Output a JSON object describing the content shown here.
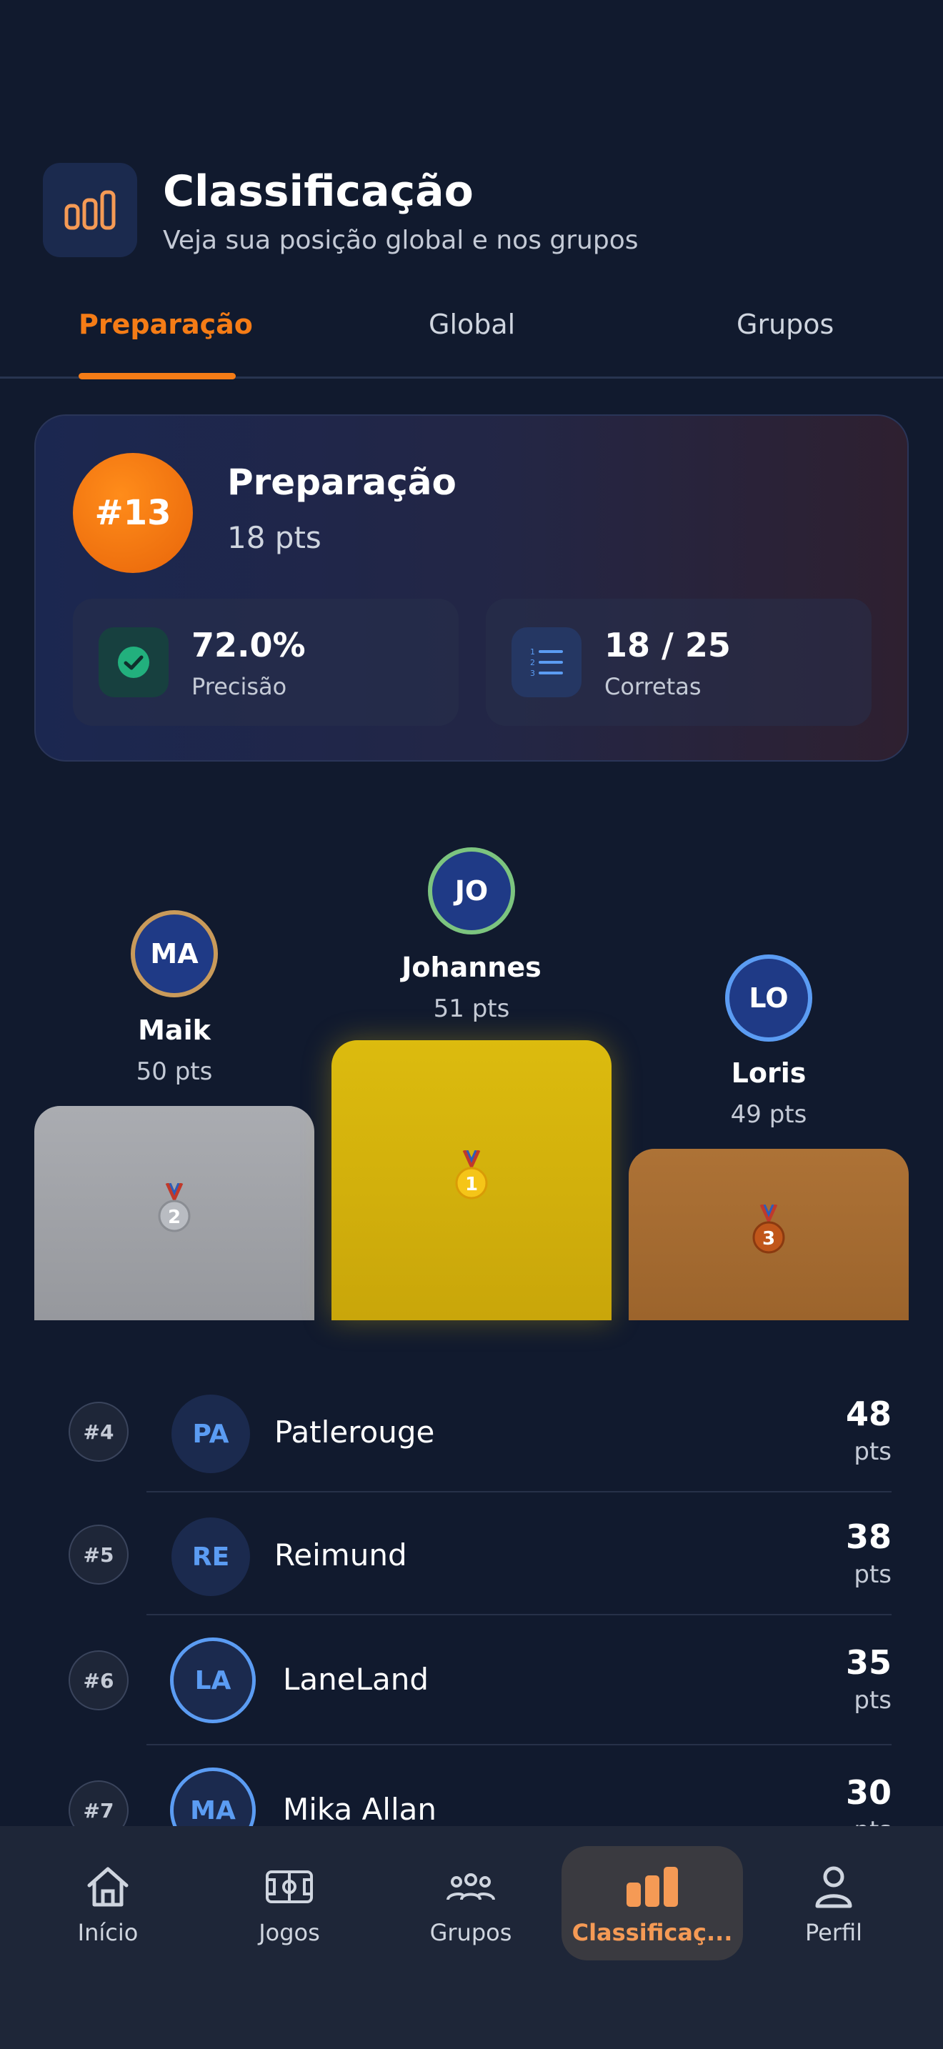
{
  "header": {
    "icon": "bar-chart-icon",
    "title": "Classificação",
    "subtitle": "Veja sua posição global e nos grupos"
  },
  "tabs": [
    {
      "label": "Preparação",
      "active": true
    },
    {
      "label": "Global",
      "active": false
    },
    {
      "label": "Grupos",
      "active": false
    }
  ],
  "summary": {
    "rank": "#13",
    "title": "Preparação",
    "points": "18 pts",
    "precision_value": "72.0%",
    "precision_label": "Precisão",
    "correct_value": "18 / 25",
    "correct_label": "Corretas",
    "precision_icon": "check-circle-icon",
    "correct_icon": "numbered-list-icon"
  },
  "podium": [
    {
      "place": 2,
      "initials": "MA",
      "name": "Maik",
      "points": "50 pts",
      "medal": "2",
      "ring_color": "#c99a5a",
      "block_color": "#a3a5aa"
    },
    {
      "place": 1,
      "initials": "JO",
      "name": "Johannes",
      "points": "51 pts",
      "medal": "1",
      "ring_color": "#7cc47f",
      "block_color": "#d6b40d"
    },
    {
      "place": 3,
      "initials": "LO",
      "name": "Loris",
      "points": "49 pts",
      "medal": "3",
      "ring_color": "#5b9cf3",
      "block_color": "#a86d32"
    }
  ],
  "ranking": [
    {
      "rank": "#4",
      "initials": "PA",
      "name": "Patlerouge",
      "score": "48",
      "unit": "pts"
    },
    {
      "rank": "#5",
      "initials": "RE",
      "name": "Reimund",
      "score": "38",
      "unit": "pts"
    },
    {
      "rank": "#6",
      "initials": "LA",
      "name": "LaneLand",
      "score": "35",
      "unit": "pts"
    },
    {
      "rank": "#7",
      "initials": "MA",
      "name": "Mika Allan",
      "score": "30",
      "unit": "pts"
    }
  ],
  "nav": [
    {
      "label": "Início",
      "icon": "home-icon",
      "active": false
    },
    {
      "label": "Jogos",
      "icon": "soccer-field-icon",
      "active": false
    },
    {
      "label": "Grupos",
      "icon": "group-icon",
      "active": false
    },
    {
      "label": "Classificaç...",
      "icon": "bar-chart-icon",
      "active": true
    },
    {
      "label": "Perfil",
      "icon": "user-icon",
      "active": false
    }
  ],
  "colors": {
    "accent": "#f57c16",
    "background": "#111a2e",
    "nav_background": "#1e2638"
  }
}
